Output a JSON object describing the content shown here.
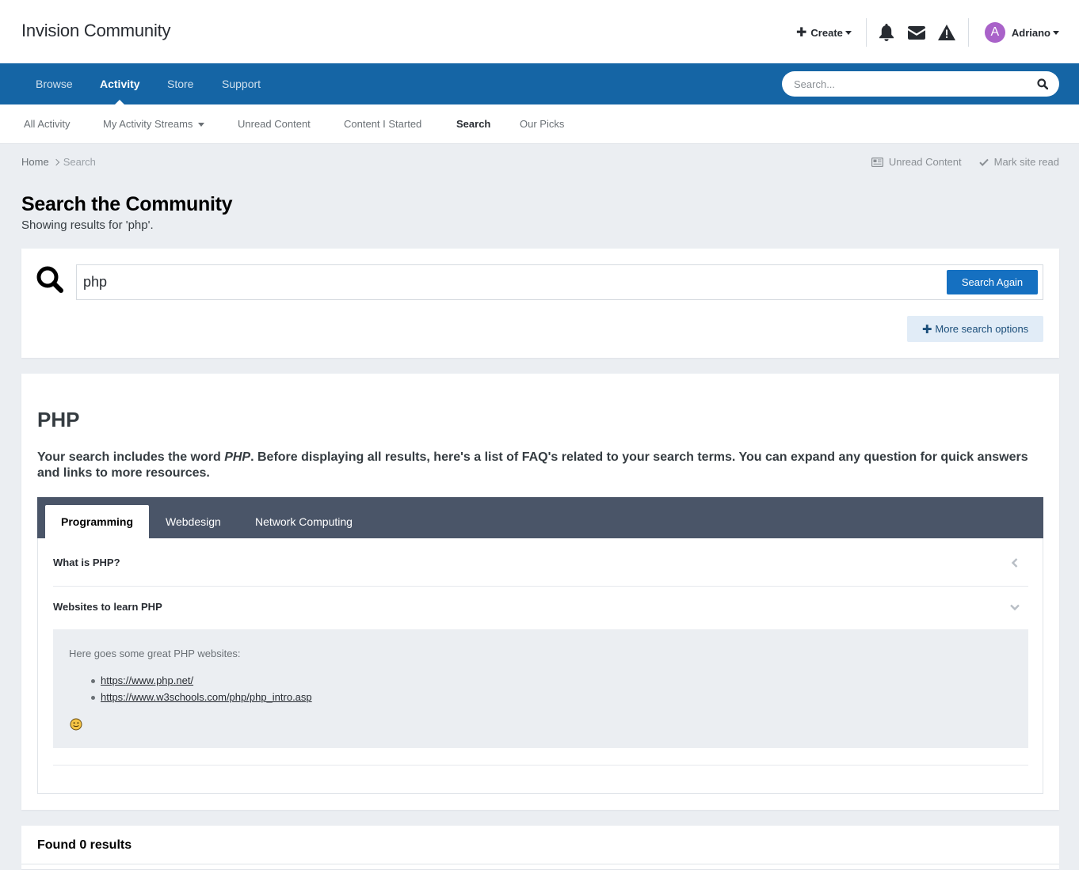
{
  "header": {
    "site_title": "Invision Community",
    "create_label": "Create",
    "user": {
      "name": "Adriano",
      "avatar_letter": "A",
      "avatar_color": "#a962c9"
    },
    "icons": [
      "bell-icon",
      "envelope-icon",
      "warning-icon"
    ]
  },
  "primary_nav": {
    "items": [
      {
        "label": "Browse",
        "active": false
      },
      {
        "label": "Activity",
        "active": true
      },
      {
        "label": "Store",
        "active": false
      },
      {
        "label": "Support",
        "active": false
      }
    ],
    "search_placeholder": "Search...",
    "bg_color": "#1565a5"
  },
  "secondary_nav": {
    "items": [
      {
        "label": "All Activity"
      },
      {
        "label": "My Activity Streams",
        "dropdown": true
      },
      {
        "label": "Unread Content"
      },
      {
        "label": "Content I Started"
      },
      {
        "label": "Search",
        "active": true
      },
      {
        "label": "Our Picks"
      }
    ]
  },
  "breadcrumb": {
    "home": "Home",
    "current": "Search"
  },
  "page_actions": {
    "unread": "Unread Content",
    "mark_read": "Mark site read"
  },
  "page": {
    "title": "Search the Community",
    "subtitle": "Showing results for 'php'."
  },
  "search": {
    "query": "php",
    "search_again_label": "Search Again",
    "more_options_label": "More search options",
    "accent_color": "#1570c1"
  },
  "faq": {
    "heading": "PHP",
    "intro_before": "Your search includes the word ",
    "intro_word": "PHP",
    "intro_after": ". Before displaying all results, here's a list of FAQ's related to your search terms. You can expand any question for quick answers and links to more resources.",
    "tabs": [
      {
        "label": "Programming",
        "active": true
      },
      {
        "label": "Webdesign",
        "active": false
      },
      {
        "label": "Network Computing",
        "active": false
      }
    ],
    "questions": [
      {
        "q": "What is PHP?",
        "expanded": false
      },
      {
        "q": "Websites to learn PHP",
        "expanded": true
      }
    ],
    "answer": {
      "intro": "Here goes some great PHP websites:",
      "links": [
        "https://www.php.net/",
        "https://www.w3schools.com/php/php_intro.asp"
      ]
    }
  },
  "results": {
    "title": "Found 0 results"
  }
}
